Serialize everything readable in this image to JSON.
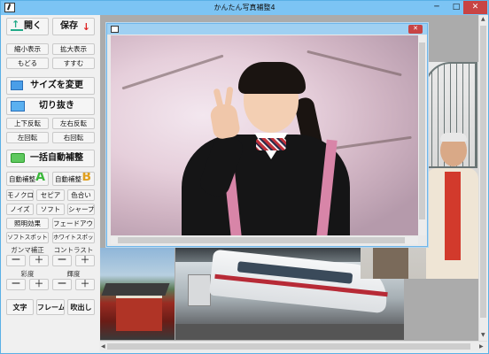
{
  "window": {
    "title": "かんたん写真補整4"
  },
  "titlebar_buttons": {
    "minimize": "─",
    "maximize": "□",
    "close": "✕"
  },
  "panel": {
    "open_label": "開く",
    "save_label": "保存",
    "zoom_out_label": "縮小表示",
    "zoom_in_label": "拡大表示",
    "undo_label": "もどる",
    "redo_label": "すすむ",
    "resize_label": "サイズを変更",
    "crop_label": "切り抜き",
    "flip_v_label": "上下反転",
    "flip_h_label": "左右反転",
    "rotate_left_label": "左回転",
    "rotate_right_label": "右回転",
    "auto_all_label": "一括自動補整",
    "auto_a_label": "自動補整",
    "auto_a_letter": "A",
    "auto_b_label": "自動補整",
    "auto_b_letter": "B",
    "mono_label": "モノクロ",
    "sepia_label": "セピア",
    "color_label": "色合い",
    "noise_label": "ノイズ",
    "soft_label": "ソフト",
    "sharp_label": "シャープ",
    "light_label": "照明効果",
    "fade_label": "フェードアウト",
    "softspot_label": "ソフトスポット",
    "whitespot_label": "ホワイトスポット",
    "gamma_label": "ガンマ補正",
    "contrast_label": "コントラスト",
    "saturation_label": "彩度",
    "brightness_label": "輝度",
    "minus": "ー",
    "plus": "＋",
    "text_label": "文字",
    "frame_label": "フレーム",
    "balloon_label": "吹出し"
  },
  "child_window": {
    "close": "✕"
  },
  "scroll_arrows": {
    "up": "▲",
    "down": "▼",
    "left": "◀",
    "right": "▶"
  }
}
